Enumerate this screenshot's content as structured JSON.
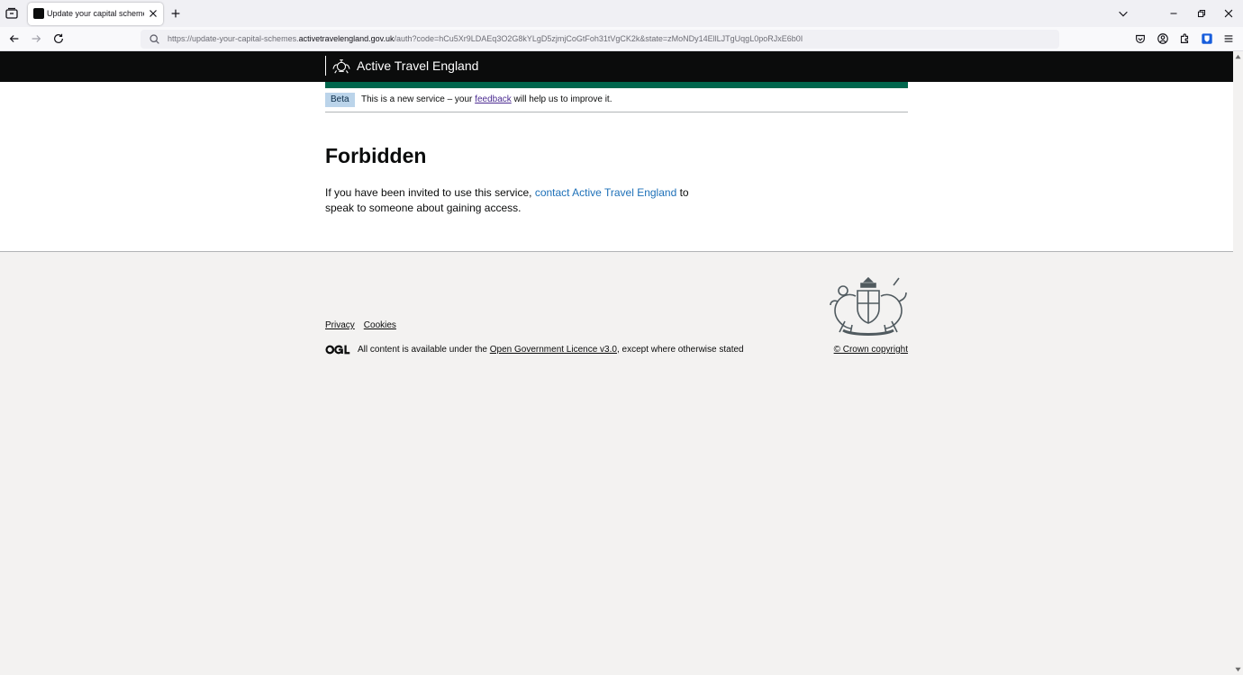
{
  "browser": {
    "tab_title": "Update your capital schemes",
    "url_prefix": "https://update-your-capital-schemes.",
    "url_domain": "activetravelengland.gov.uk",
    "url_suffix": "/auth?code=hCu5Xr9LDAEq3O2G8kYLgD5zjmjCoGtFoh31tVgCK2k&state=zMoNDy14EllLJTgUqgL0poRJxE6b0I"
  },
  "header": {
    "service_name": "Active Travel England"
  },
  "phase_banner": {
    "tag": "Beta",
    "text_before": "This is a new service – your ",
    "link": "feedback",
    "text_after": " will help us to improve it."
  },
  "main": {
    "title": "Forbidden",
    "text_before": "If you have been invited to use this service, ",
    "link": "contact Active Travel England",
    "text_after": " to speak to someone about gaining access."
  },
  "footer": {
    "links": [
      "Privacy",
      "Cookies"
    ],
    "licence_before": "All content is available under the ",
    "licence_link": "Open Government Licence v3.0",
    "licence_after": ", except where otherwise stated",
    "copyright": "© Crown copyright"
  },
  "colors": {
    "header_bg": "#0b0c0c",
    "accent_green": "#00664d",
    "link_blue": "#1d70b8",
    "visited_purple": "#4c2c92",
    "footer_bg": "#f3f2f1"
  },
  "icons": [
    "tab-list-icon",
    "favicon-icon",
    "close-icon",
    "plus-icon",
    "chevron-down-icon",
    "minimize-icon",
    "restore-icon",
    "back-icon",
    "forward-icon",
    "reload-icon",
    "search-icon",
    "pocket-icon",
    "account-icon",
    "extensions-icon",
    "bitwarden-icon",
    "menu-icon",
    "crest-icon",
    "ogl-icon",
    "royal-arms-icon"
  ]
}
